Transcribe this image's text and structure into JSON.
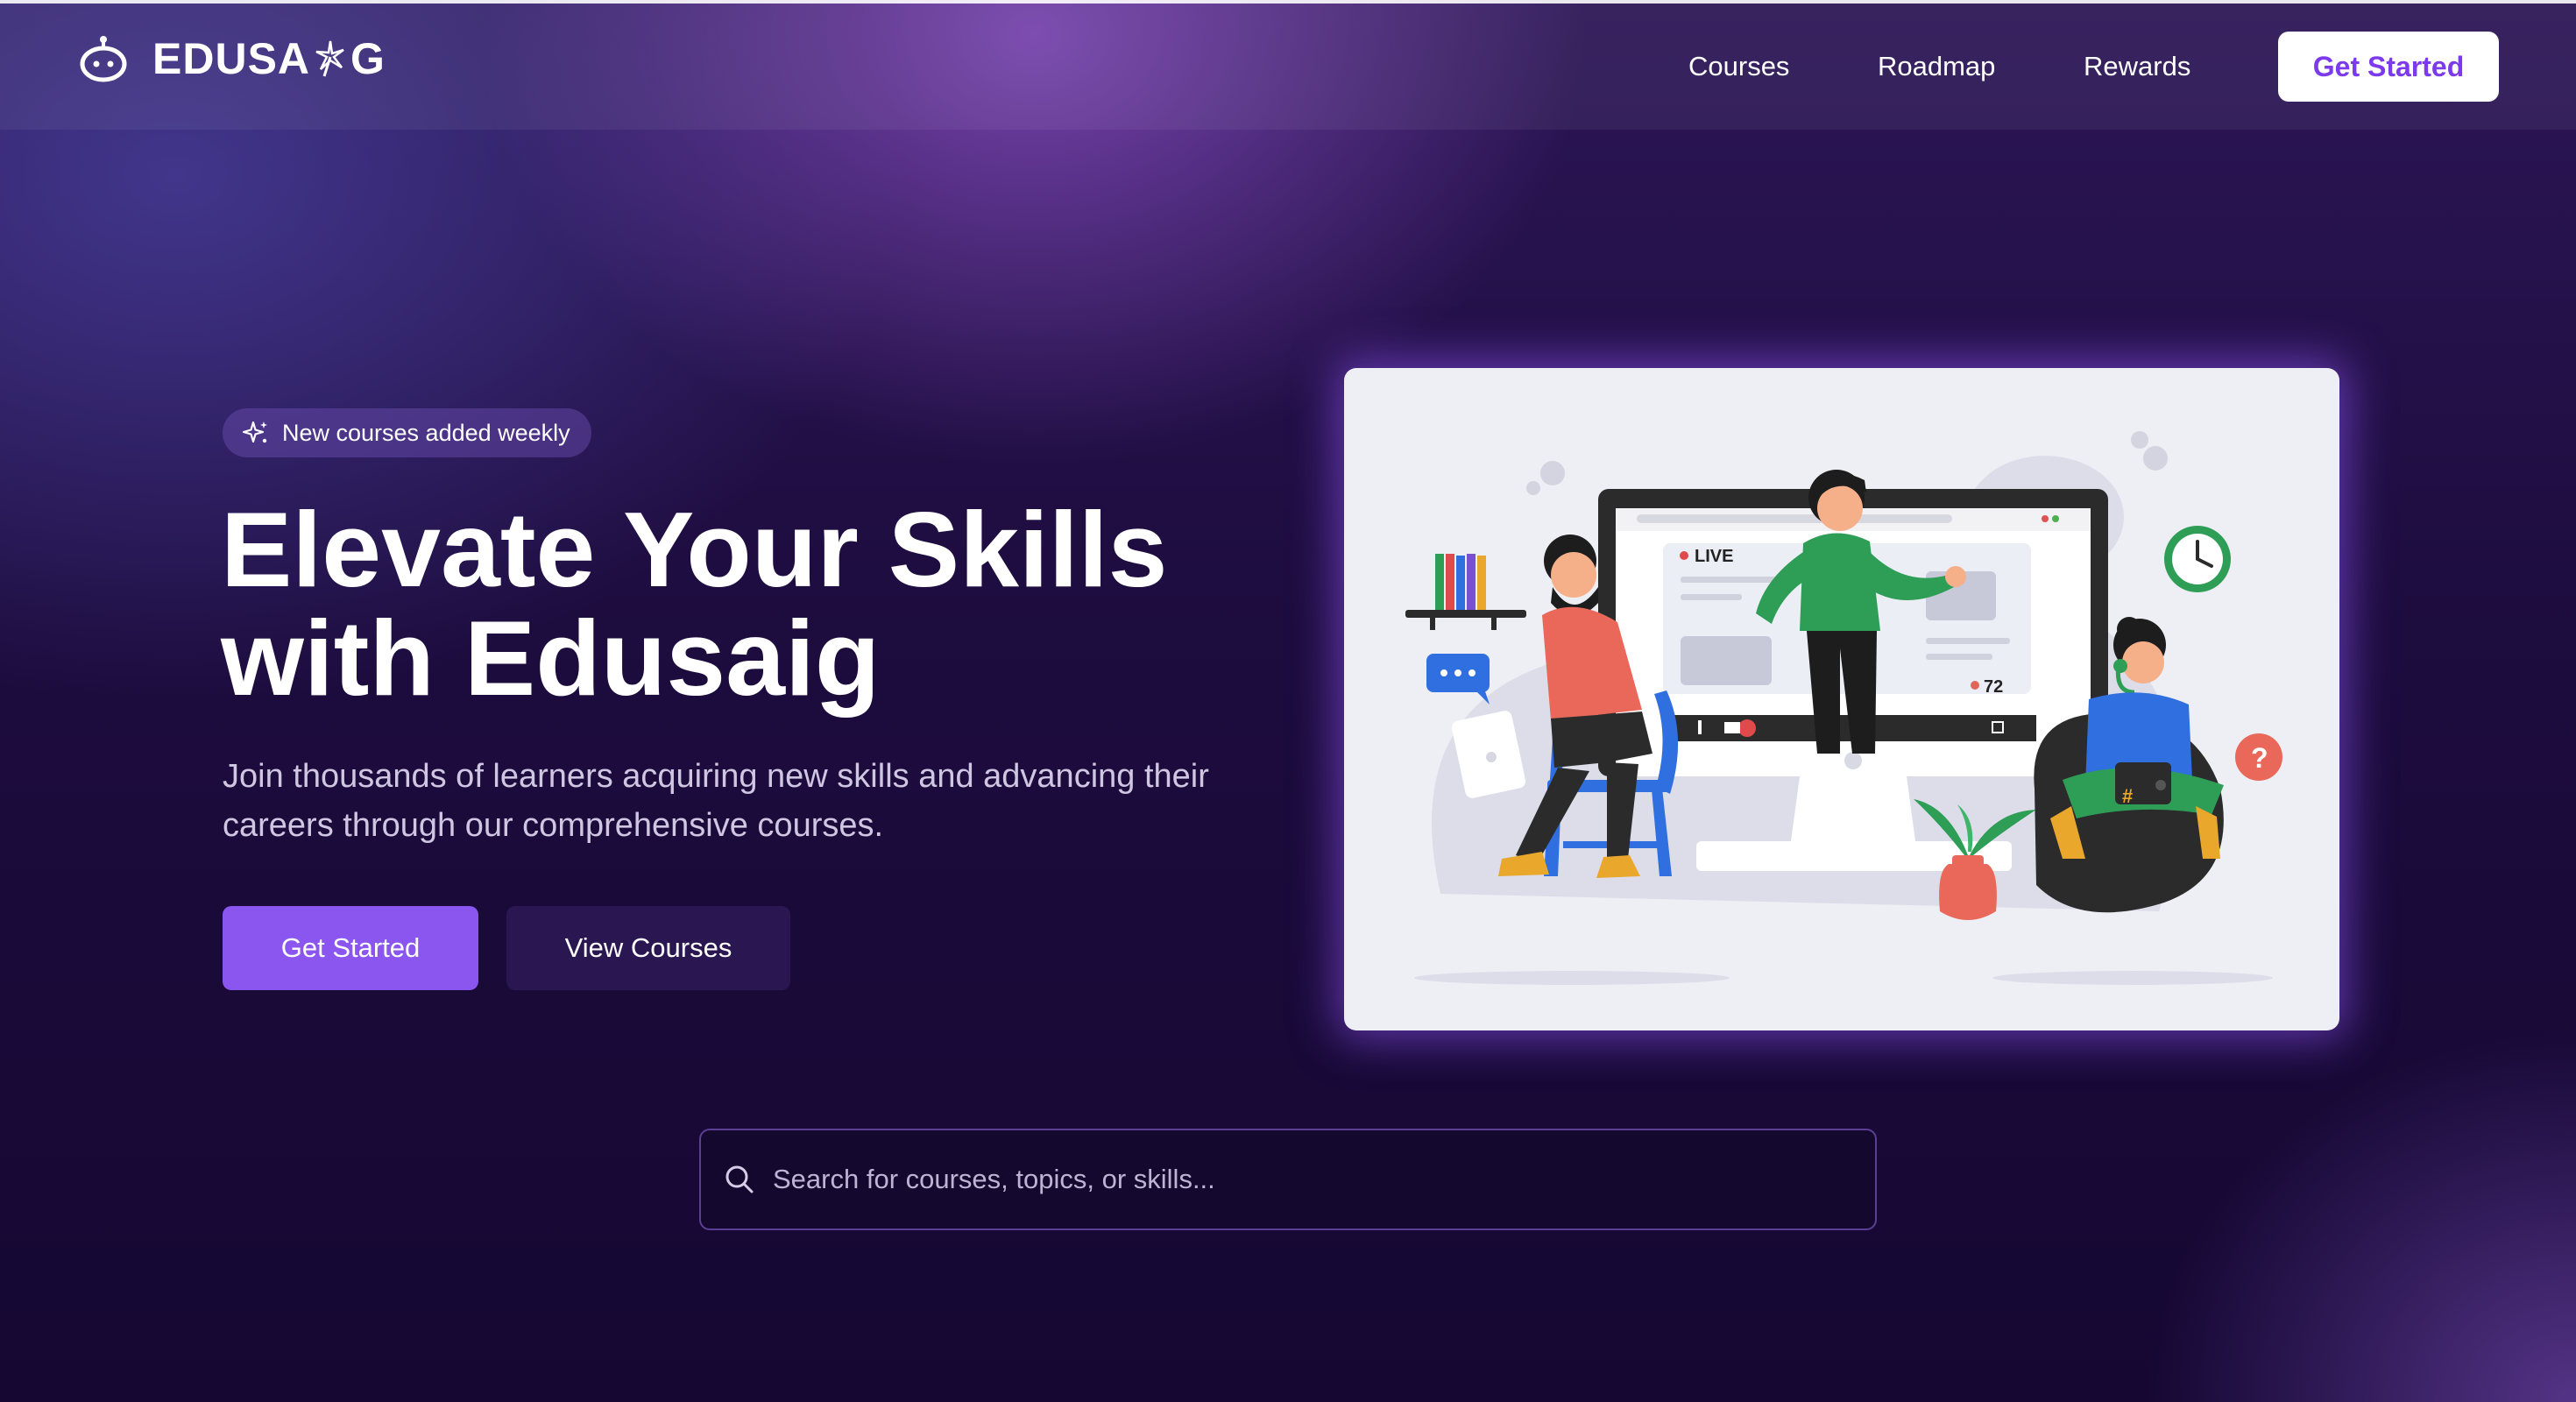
{
  "nav": {
    "logo_text_before": "EDUSA",
    "logo_text_after": "G",
    "links": [
      {
        "label": "Courses"
      },
      {
        "label": "Roadmap"
      },
      {
        "label": "Rewards"
      }
    ],
    "cta_label": "Get Started"
  },
  "hero": {
    "badge_label": "New courses added weekly",
    "title_line1": "Elevate Your Skills",
    "title_line2": "with Edusaig",
    "subtitle": "Join thousands of learners acquiring new skills and advancing their careers through our comprehensive courses.",
    "primary_button": "Get Started",
    "secondary_button": "View Courses"
  },
  "illustration": {
    "live_label": "LIVE",
    "viewer_count": "72"
  },
  "search": {
    "placeholder": "Search for courses, topics, or skills..."
  },
  "colors": {
    "accent": "#8b55f0",
    "cta_text": "#7c3aed",
    "background": "#14072b"
  },
  "icons": [
    "robot-logo-icon",
    "sparkle-icon",
    "search-icon"
  ]
}
